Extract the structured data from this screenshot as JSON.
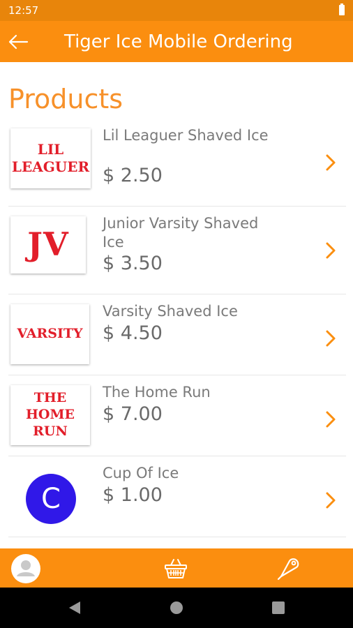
{
  "status_bar": {
    "time": "12:57"
  },
  "app_bar": {
    "title": "Tiger Ice Mobile Ordering",
    "back_icon": "arrow-left-icon"
  },
  "page": {
    "heading": "Products"
  },
  "products": [
    {
      "name": "Lil Leaguer Shaved Ice",
      "price": "$ 2.50",
      "logo_lines": [
        "LIL",
        "LEAGUER"
      ]
    },
    {
      "name": "Junior Varsity Shaved Ice",
      "price": "$ 3.50",
      "logo_lines": [
        "JV"
      ]
    },
    {
      "name": "Varsity Shaved Ice",
      "price": "$ 4.50",
      "logo_lines": [
        "VARSITY"
      ]
    },
    {
      "name": "The Home Run",
      "price": "$ 7.00",
      "logo_lines": [
        "THE",
        "HOME",
        "RUN"
      ]
    },
    {
      "name": "Cup Of Ice",
      "price": "$ 1.00",
      "avatar_letter": "C"
    }
  ],
  "bottom_bar": {
    "items": [
      "profile-icon",
      "basket-icon",
      "tag-icon"
    ]
  },
  "colors": {
    "status": "#e8850b",
    "primary": "#fb8e0f",
    "heading": "#f7912a",
    "logo_red": "#e21e2a",
    "avatar": "#3018e8"
  }
}
